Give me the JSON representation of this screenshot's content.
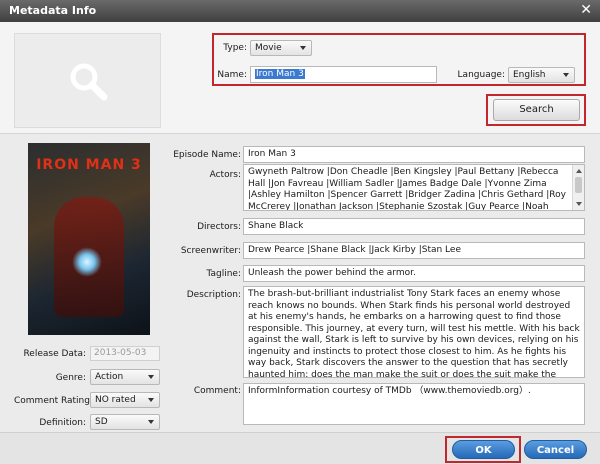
{
  "window": {
    "title": "Metadata Info",
    "close_glyph": "✕"
  },
  "search": {
    "type_label": "Type:",
    "type_value": "Movie",
    "name_label": "Name:",
    "name_value": "Iron Man 3",
    "language_label": "Language:",
    "language_value": "English",
    "button_label": "Search"
  },
  "poster": {
    "title_text": "IRON MAN 3"
  },
  "left": {
    "release_label": "Release Data:",
    "release_value": "2013-05-03",
    "genre_label": "Genre:",
    "genre_value": "Action",
    "rating_label": "Comment Rating:",
    "rating_value": "NO rated",
    "definition_label": "Definition:",
    "definition_value": "SD"
  },
  "fields": {
    "episode_label": "Episode Name:",
    "episode_value": "Iron Man 3",
    "actors_label": "Actors:",
    "actors_value": "Gwyneth Paltrow |Don Cheadle |Ben Kingsley |Paul Bettany |Rebecca Hall |Jon Favreau |William Sadler |James Badge Dale |Yvonne Zima |Ashley Hamilton |Spencer Garrett |Bridger Zadina |Chris Gethard |Roy McCrerey |Jonathan Jackson |Stephanie Szostak |Guy Pearce |Noah Visconti |Ty Simpkins |Jenna Ortega |Bronte D'Esposito |",
    "directors_label": "Directors:",
    "directors_value": "Shane Black",
    "screenwriter_label": "Screenwriter:",
    "screenwriter_value": "Drew Pearce |Shane Black |Jack Kirby |Stan Lee",
    "tagline_label": "Tagline:",
    "tagline_value": "Unleash the power behind the armor.",
    "description_label": "Description:",
    "description_value": "The brash-but-brilliant industrialist Tony Stark faces an enemy whose reach knows no bounds. When Stark finds his personal world destroyed at his enemy's hands, he embarks on a harrowing quest to find those responsible. This journey, at every turn, will test his mettle. With his back against the wall, Stark is left to survive by his own devices, relying on his ingenuity and instincts to protect those closest to him. As he fights his way back, Stark discovers the answer to the question that has secretly haunted him: does the man make the suit or does the suit make the man?",
    "comment_label": "Comment:",
    "comment_value": "InformInformation courtesy of TMDb （www.themoviedb.org）."
  },
  "footer": {
    "ok_label": "OK",
    "cancel_label": "Cancel"
  },
  "colors": {
    "highlight_box": "#c1272d",
    "button_blue": "#2569b8",
    "titlebar": "#4a4a4a"
  },
  "icons": {
    "thumbnail": "magnifier-icon"
  }
}
